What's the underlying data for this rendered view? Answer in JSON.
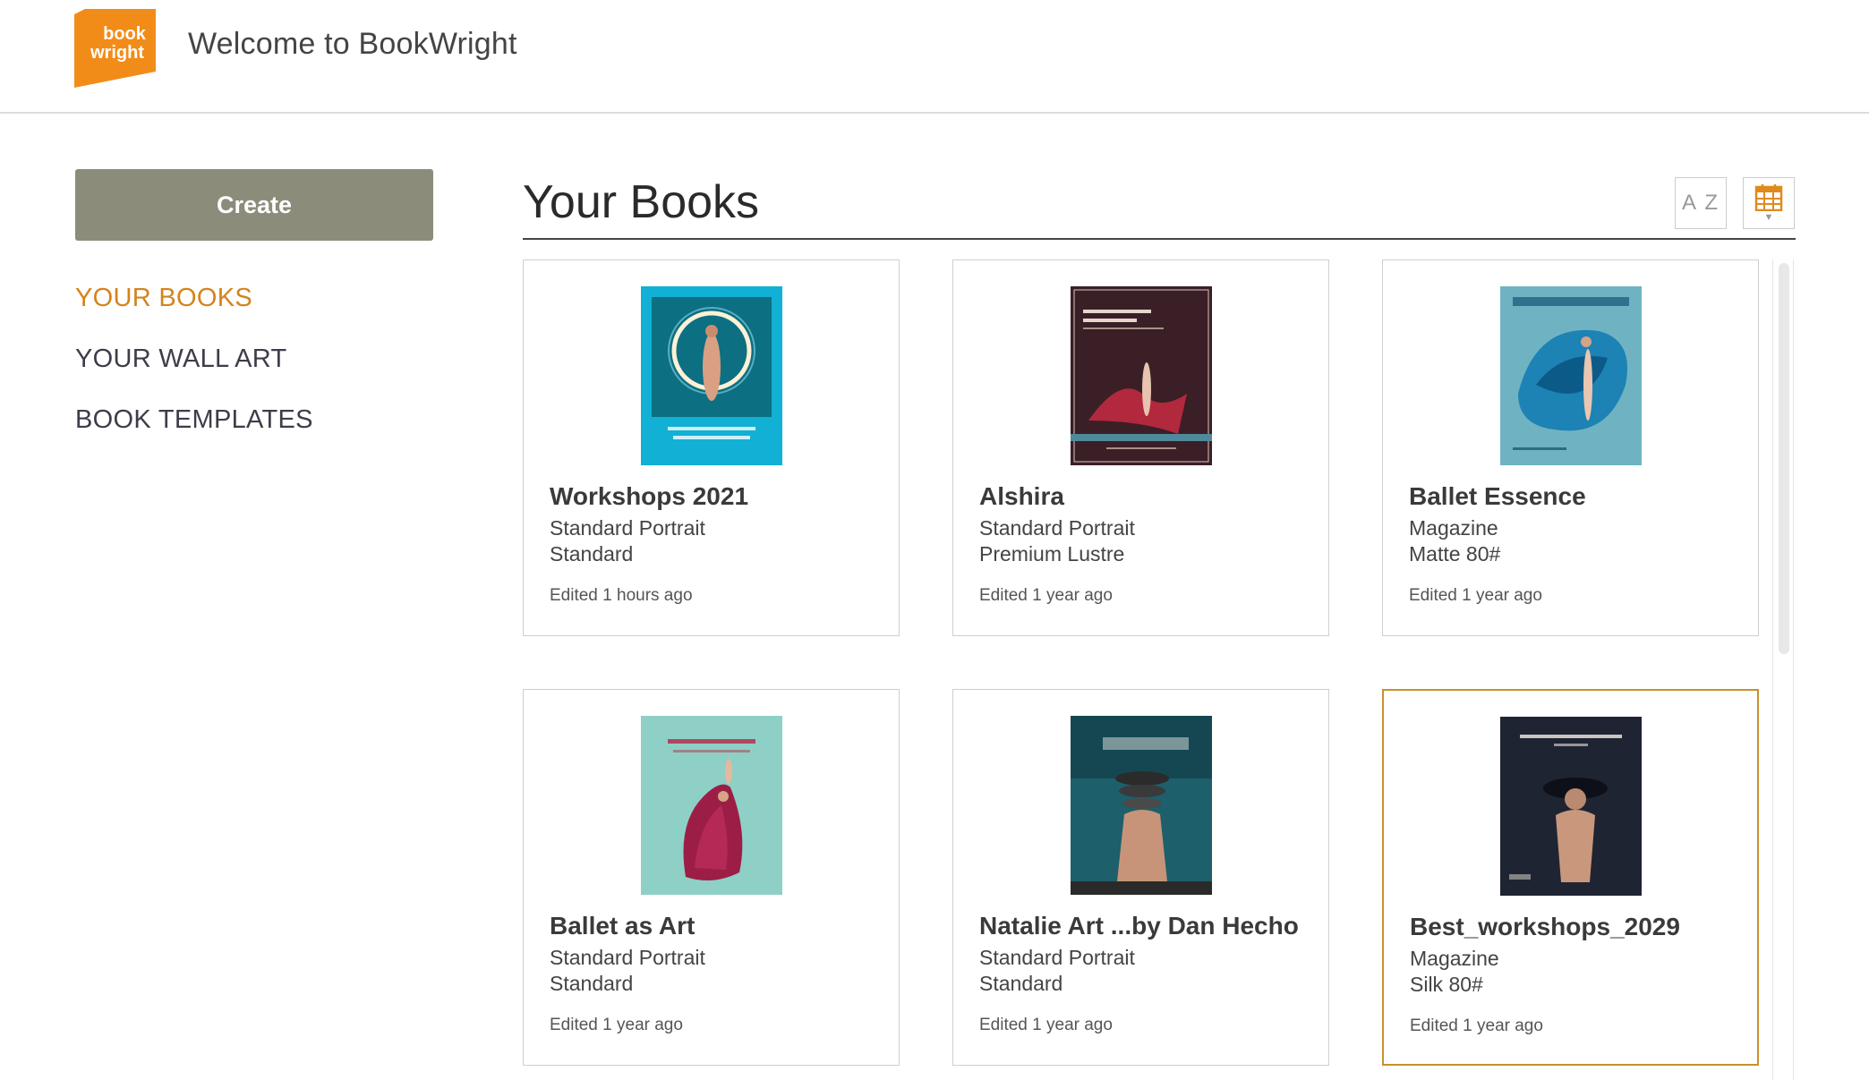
{
  "header": {
    "logo_line1": "book",
    "logo_line2": "wright",
    "title": "Welcome to BookWright"
  },
  "sidebar": {
    "create_label": "Create",
    "items": [
      {
        "label": "YOUR BOOKS",
        "active": true
      },
      {
        "label": "YOUR WALL ART",
        "active": false
      },
      {
        "label": "BOOK TEMPLATES",
        "active": false
      }
    ]
  },
  "main": {
    "title": "Your Books",
    "sort_alpha_label": "A Z",
    "sort_date_icon": "calendar-icon"
  },
  "books": [
    {
      "title": "Workshops 2021",
      "format": "Standard Portrait",
      "paper": "Standard",
      "edited": "Edited 1 hours ago"
    },
    {
      "title": "Alshira",
      "format": "Standard Portrait",
      "paper": "Premium Lustre",
      "edited": "Edited 1 year ago"
    },
    {
      "title": "Ballet Essence",
      "format": "Magazine",
      "paper": "Matte 80#",
      "edited": "Edited 1 year ago"
    },
    {
      "title": "Ballet as Art",
      "format": "Standard Portrait",
      "paper": "Standard",
      "edited": "Edited 1 year ago"
    },
    {
      "title": "Natalie Art ...by Dan Hecho",
      "format": "Standard Portrait",
      "paper": "Standard",
      "edited": "Edited 1 year ago"
    },
    {
      "title": "Best_workshops_2029",
      "format": "Magazine",
      "paper": "Silk 80#",
      "edited": "Edited 1 year ago",
      "selected": true
    }
  ],
  "colors": {
    "accent": "#d4841c",
    "logo_orange": "#f28c18",
    "create_button": "#8c8c7a",
    "selected_border": "#c9902c"
  }
}
